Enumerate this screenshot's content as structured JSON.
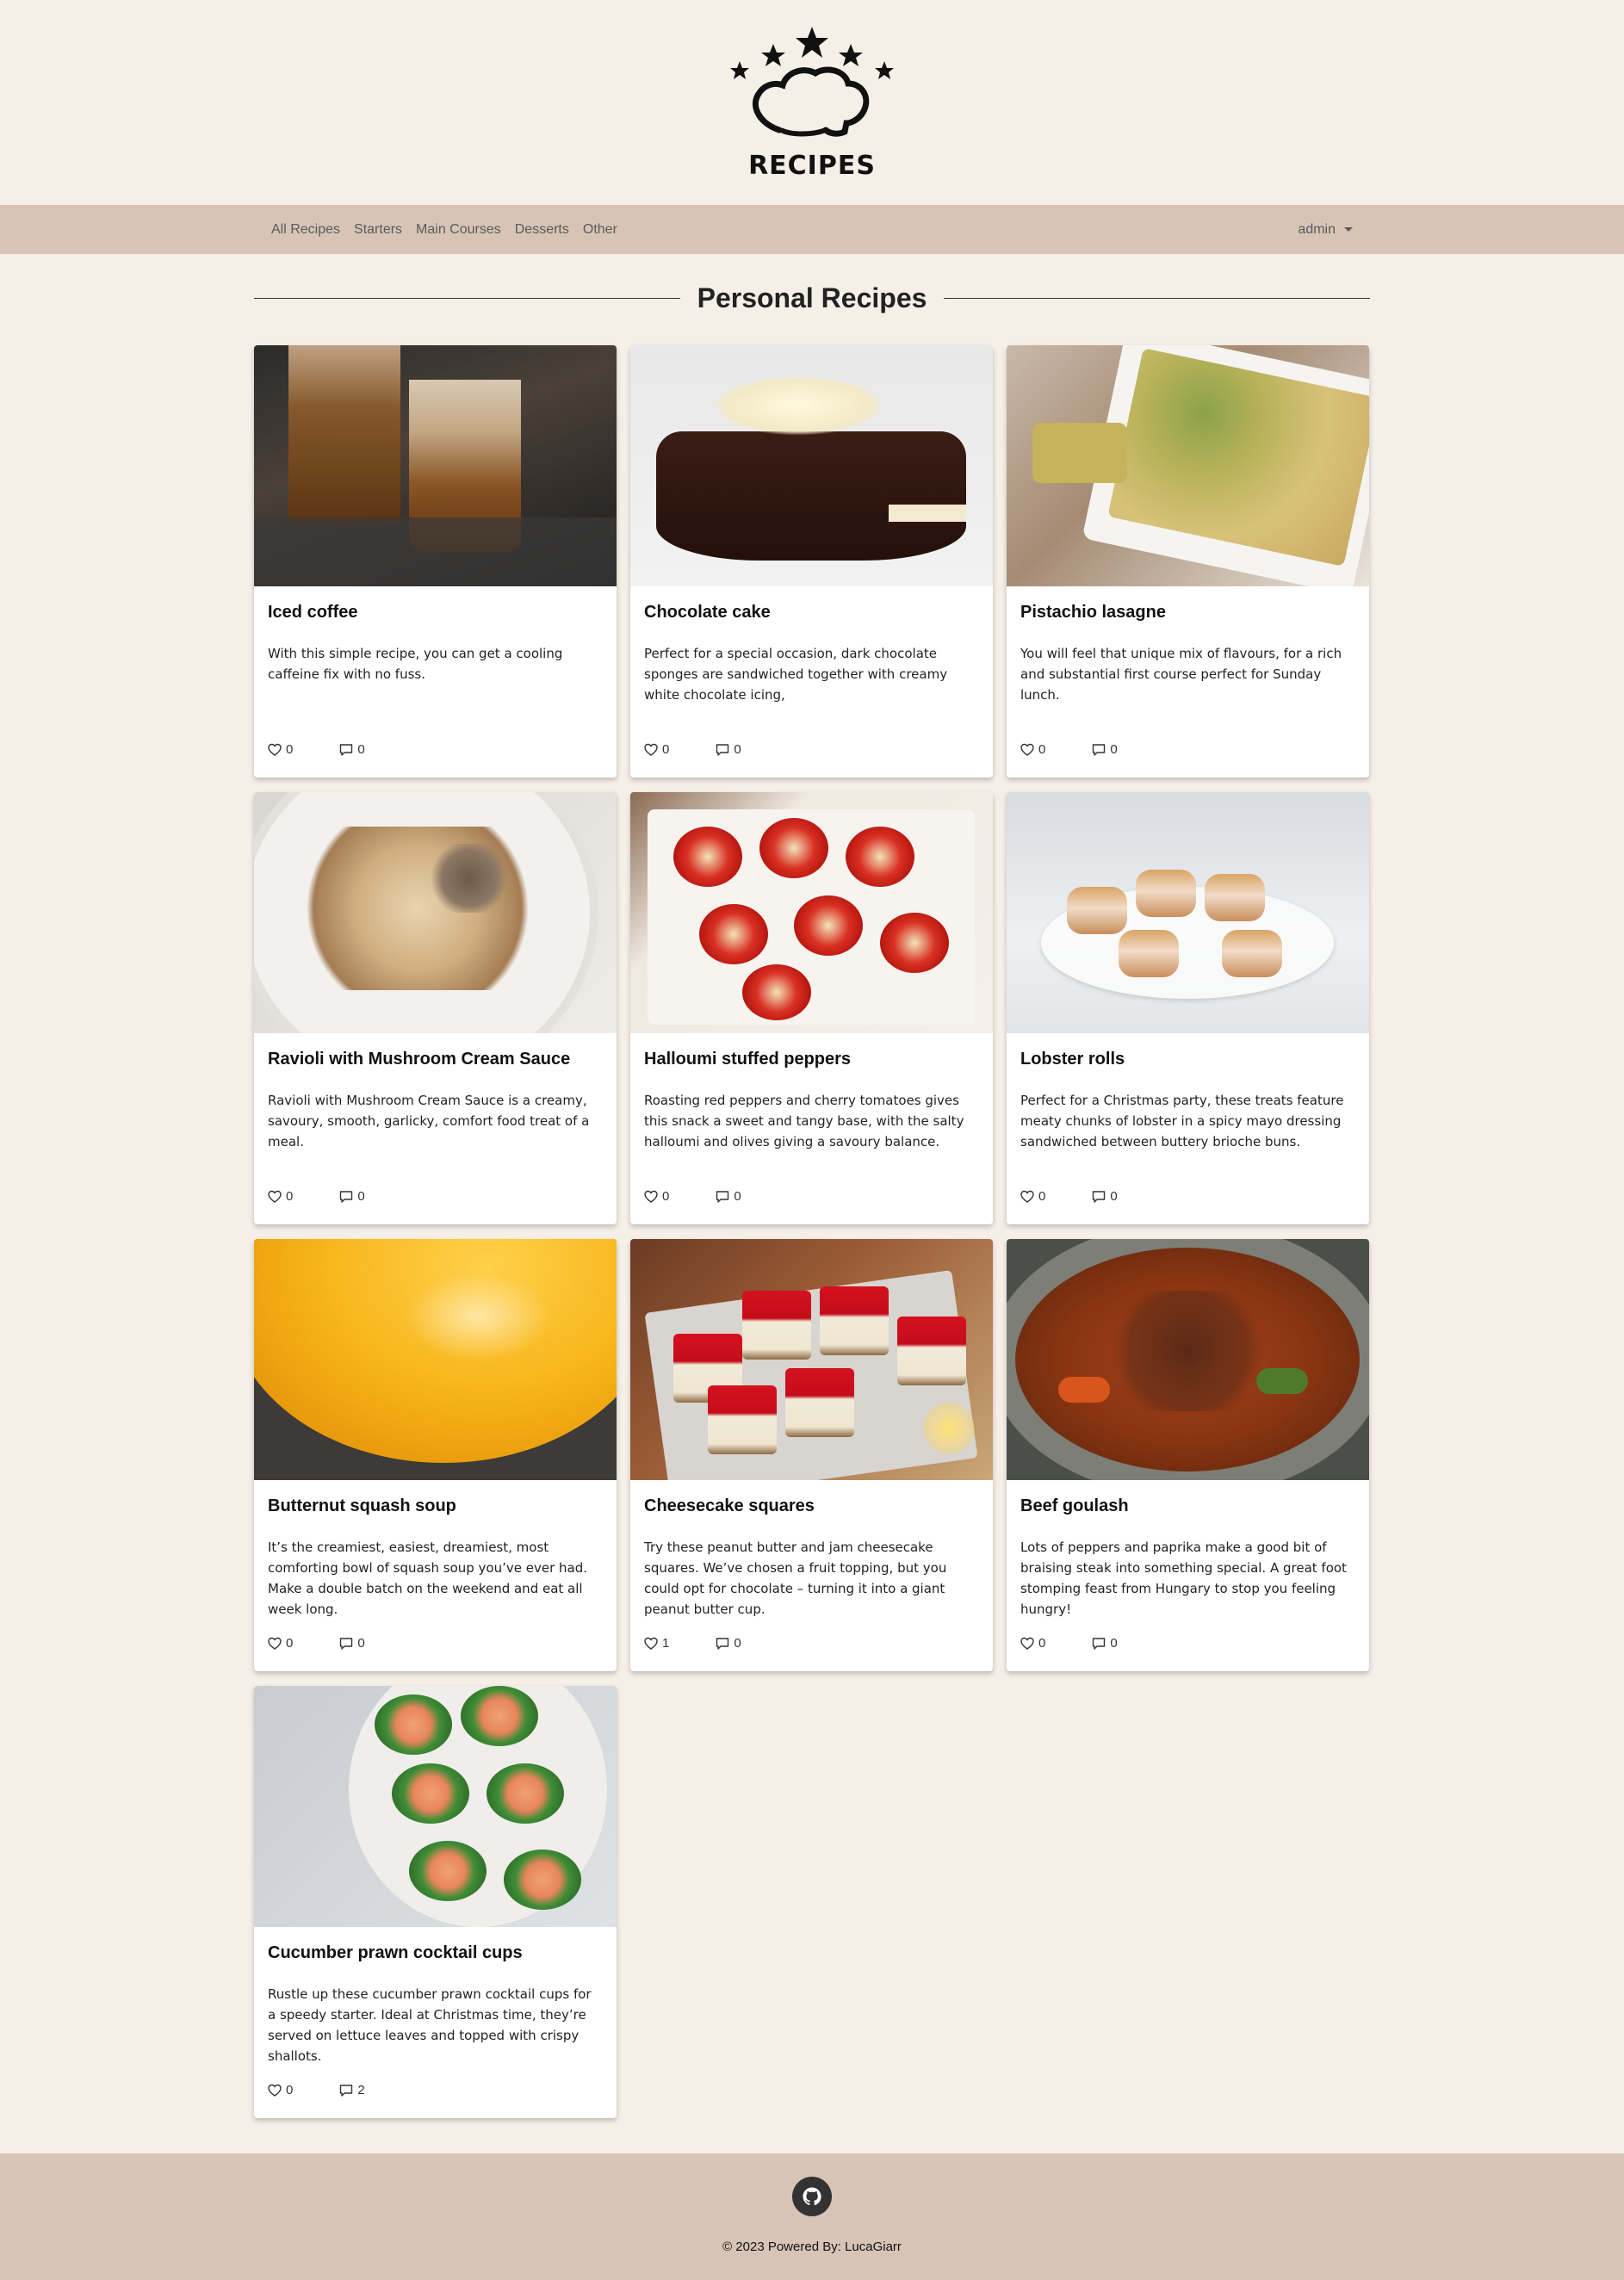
{
  "header": {
    "logo_text": "RECIPES"
  },
  "nav": {
    "links": [
      "All Recipes",
      "Starters",
      "Main Courses",
      "Desserts",
      "Other"
    ],
    "user": "admin"
  },
  "page": {
    "title": "Personal Recipes"
  },
  "recipes": [
    {
      "title": "Iced coffee",
      "description": "With this simple recipe, you can get a cooling caffeine fix with no fuss.",
      "likes": "0",
      "comments": "0"
    },
    {
      "title": "Chocolate cake",
      "description": "Perfect for a special occasion, dark chocolate sponges are sandwiched together with creamy white chocolate icing,",
      "likes": "0",
      "comments": "0"
    },
    {
      "title": "Pistachio lasagne",
      "description": "You will feel that unique mix of flavours, for a rich and substantial first course perfect for Sunday lunch.",
      "likes": "0",
      "comments": "0"
    },
    {
      "title": "Ravioli with Mushroom Cream Sauce",
      "description": "Ravioli with Mushroom Cream Sauce is a creamy, savoury, smooth, garlicky, comfort food treat of a meal.",
      "likes": "0",
      "comments": "0"
    },
    {
      "title": "Halloumi stuffed peppers",
      "description": "Roasting red peppers and cherry tomatoes gives this snack a sweet and tangy base, with the salty halloumi and olives giving a savoury balance.",
      "likes": "0",
      "comments": "0"
    },
    {
      "title": "Lobster rolls",
      "description": "Perfect for a Christmas party, these treats feature meaty chunks of lobster in a spicy mayo dressing sandwiched between buttery brioche buns.",
      "likes": "0",
      "comments": "0"
    },
    {
      "title": "Butternut squash soup",
      "description": "It’s the creamiest, easiest, dreamiest, most comforting bowl of squash soup you’ve ever had. Make a double batch on the weekend and eat all week long.",
      "likes": "0",
      "comments": "0"
    },
    {
      "title": "Cheesecake squares",
      "description": "Try these peanut butter and jam cheesecake squares. We’ve chosen a fruit topping, but you could opt for chocolate – turning it into a giant peanut butter cup.",
      "likes": "1",
      "comments": "0"
    },
    {
      "title": "Beef goulash",
      "description": "Lots of peppers and paprika make a good bit of braising steak into something special. A great foot stomping feast from Hungary to stop you feeling hungry!",
      "likes": "0",
      "comments": "0"
    },
    {
      "title": "Cucumber prawn cocktail cups",
      "description": "Rustle up these cucumber prawn cocktail cups for a speedy starter. Ideal at Christmas time, they’re served on lettuce leaves and topped with crispy shallots.",
      "likes": "0",
      "comments": "2"
    }
  ],
  "footer": {
    "text": "© 2023 Powered By: LucaGiarr",
    "icon": "github-icon"
  }
}
